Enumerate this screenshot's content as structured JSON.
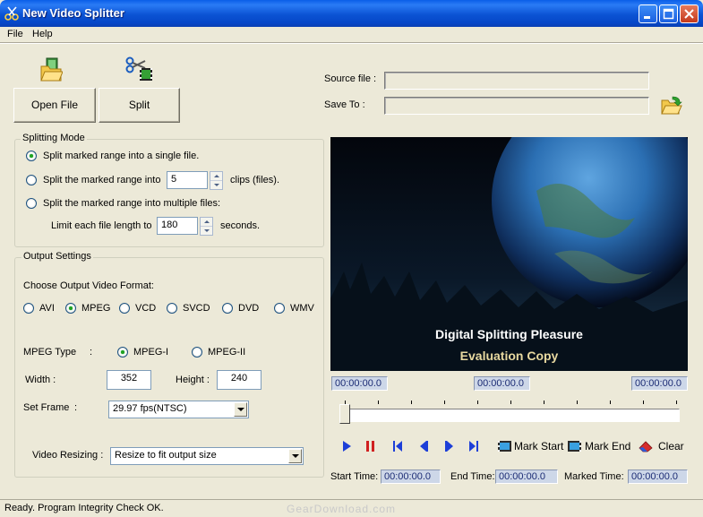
{
  "window": {
    "title": "New Video Splitter"
  },
  "menu": {
    "file": "File",
    "help": "Help"
  },
  "toolbar": {
    "open_file": "Open File",
    "split": "Split"
  },
  "files": {
    "source_label": "Source file :",
    "source_value": "",
    "save_label": "Save To :",
    "save_value": ""
  },
  "splitting_mode": {
    "title": "Splitting Mode",
    "opt_single": "Split marked range into a single file.",
    "opt_clips": "Split the marked range into",
    "clips_value": "5",
    "clips_suffix": "clips (files).",
    "opt_multiple": "Split the marked range into multiple files:",
    "limit_label": "Limit each file length to",
    "limit_value": "180",
    "limit_suffix": "seconds."
  },
  "output": {
    "title": "Output Settings",
    "choose_format": "Choose Output Video Format:",
    "formats": [
      "AVI",
      "MPEG",
      "VCD",
      "SVCD",
      "DVD",
      "WMV"
    ],
    "selected_format": "MPEG",
    "mpeg_type_label": "MPEG Type",
    "mpeg_type_colon": ":",
    "mpeg1": "MPEG-I",
    "mpeg2": "MPEG-II",
    "width_label": "Width :",
    "width_value": "352",
    "height_label": "Height :",
    "height_value": "240",
    "frame_label": "Set Frame",
    "frame_colon": ":",
    "frame_value": "29.97 fps(NTSC)",
    "resizing_label": "Video Resizing :",
    "resizing_value": "Resize to fit output size"
  },
  "preview": {
    "line1": "Digital Splitting Pleasure",
    "line2": "Evaluation Copy"
  },
  "timeline": {
    "time_left": "00:00:00.0",
    "time_mid": "00:00:00.0",
    "time_right": "00:00:00.0",
    "position": 0
  },
  "controls": {
    "mark_start": "Mark Start",
    "mark_end": "Mark End",
    "clear": "Clear"
  },
  "times": {
    "start_label": "Start Time:",
    "start_value": "00:00:00.0",
    "end_label": "End Time:",
    "end_value": "00:00:00.0",
    "marked_label": "Marked Time:",
    "marked_value": "00:00:00.0"
  },
  "status": {
    "text": "Ready. Program Integrity Check OK.",
    "watermark": "GearDownload.com"
  },
  "colors": {
    "titlebar": "#0b53d4",
    "window_bg": "#ece9d8",
    "play_blue": "#1d3fd8",
    "pause_red": "#d02020",
    "time_box": "#cdd7e8"
  }
}
